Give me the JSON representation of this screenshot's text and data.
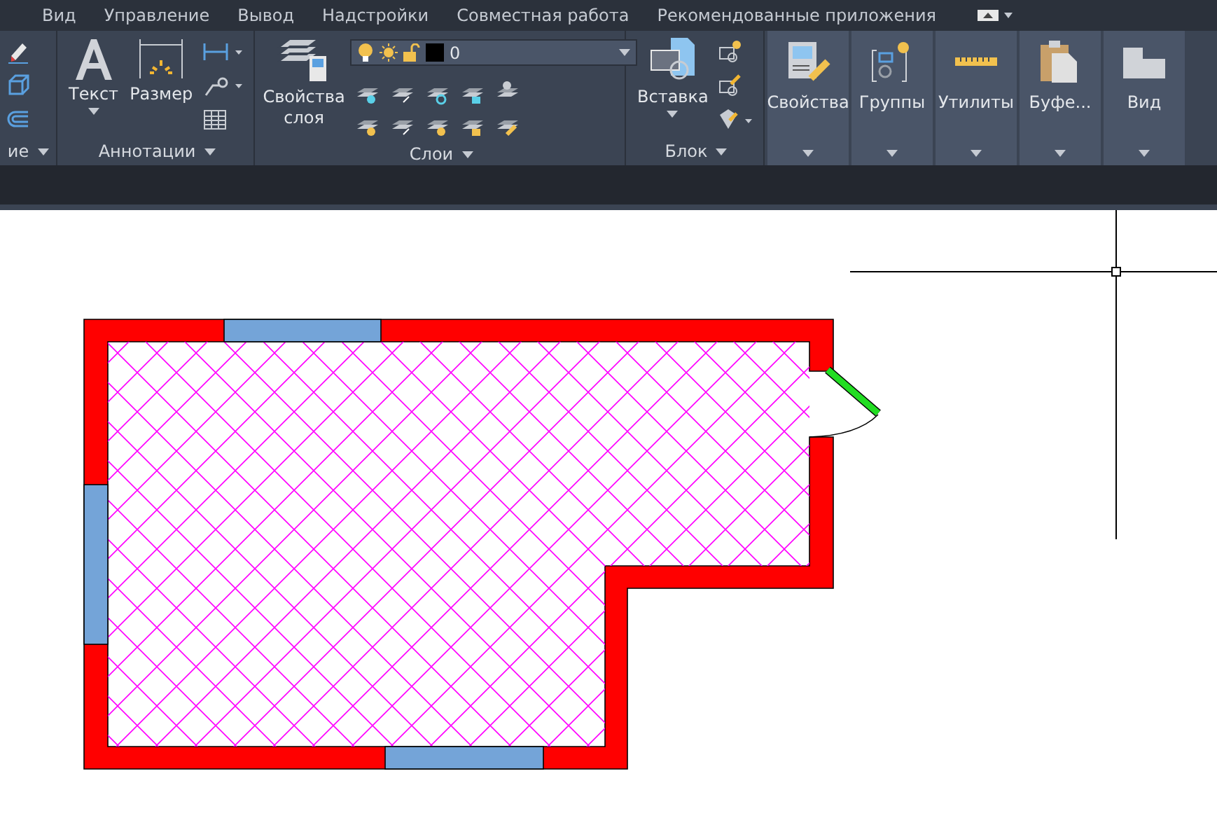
{
  "menu_tabs": [
    "Вид",
    "Управление",
    "Вывод",
    "Надстройки",
    "Совместная работа",
    "Рекомендованные приложения"
  ],
  "ribbon": {
    "panels": [
      {
        "kind": "partial",
        "title": "ие"
      },
      {
        "kind": "annotations",
        "title": "Аннотации",
        "buttons": [
          "Текст",
          "Размер"
        ]
      },
      {
        "kind": "layers",
        "title": "Слои",
        "button": "Свойства слоя",
        "layer": "0"
      },
      {
        "kind": "block",
        "title": "Блок",
        "button": "Вставка"
      }
    ],
    "collapsed_panels": [
      "Свойства",
      "Группы",
      "Утилиты",
      "Буфе...",
      "Вид"
    ]
  }
}
